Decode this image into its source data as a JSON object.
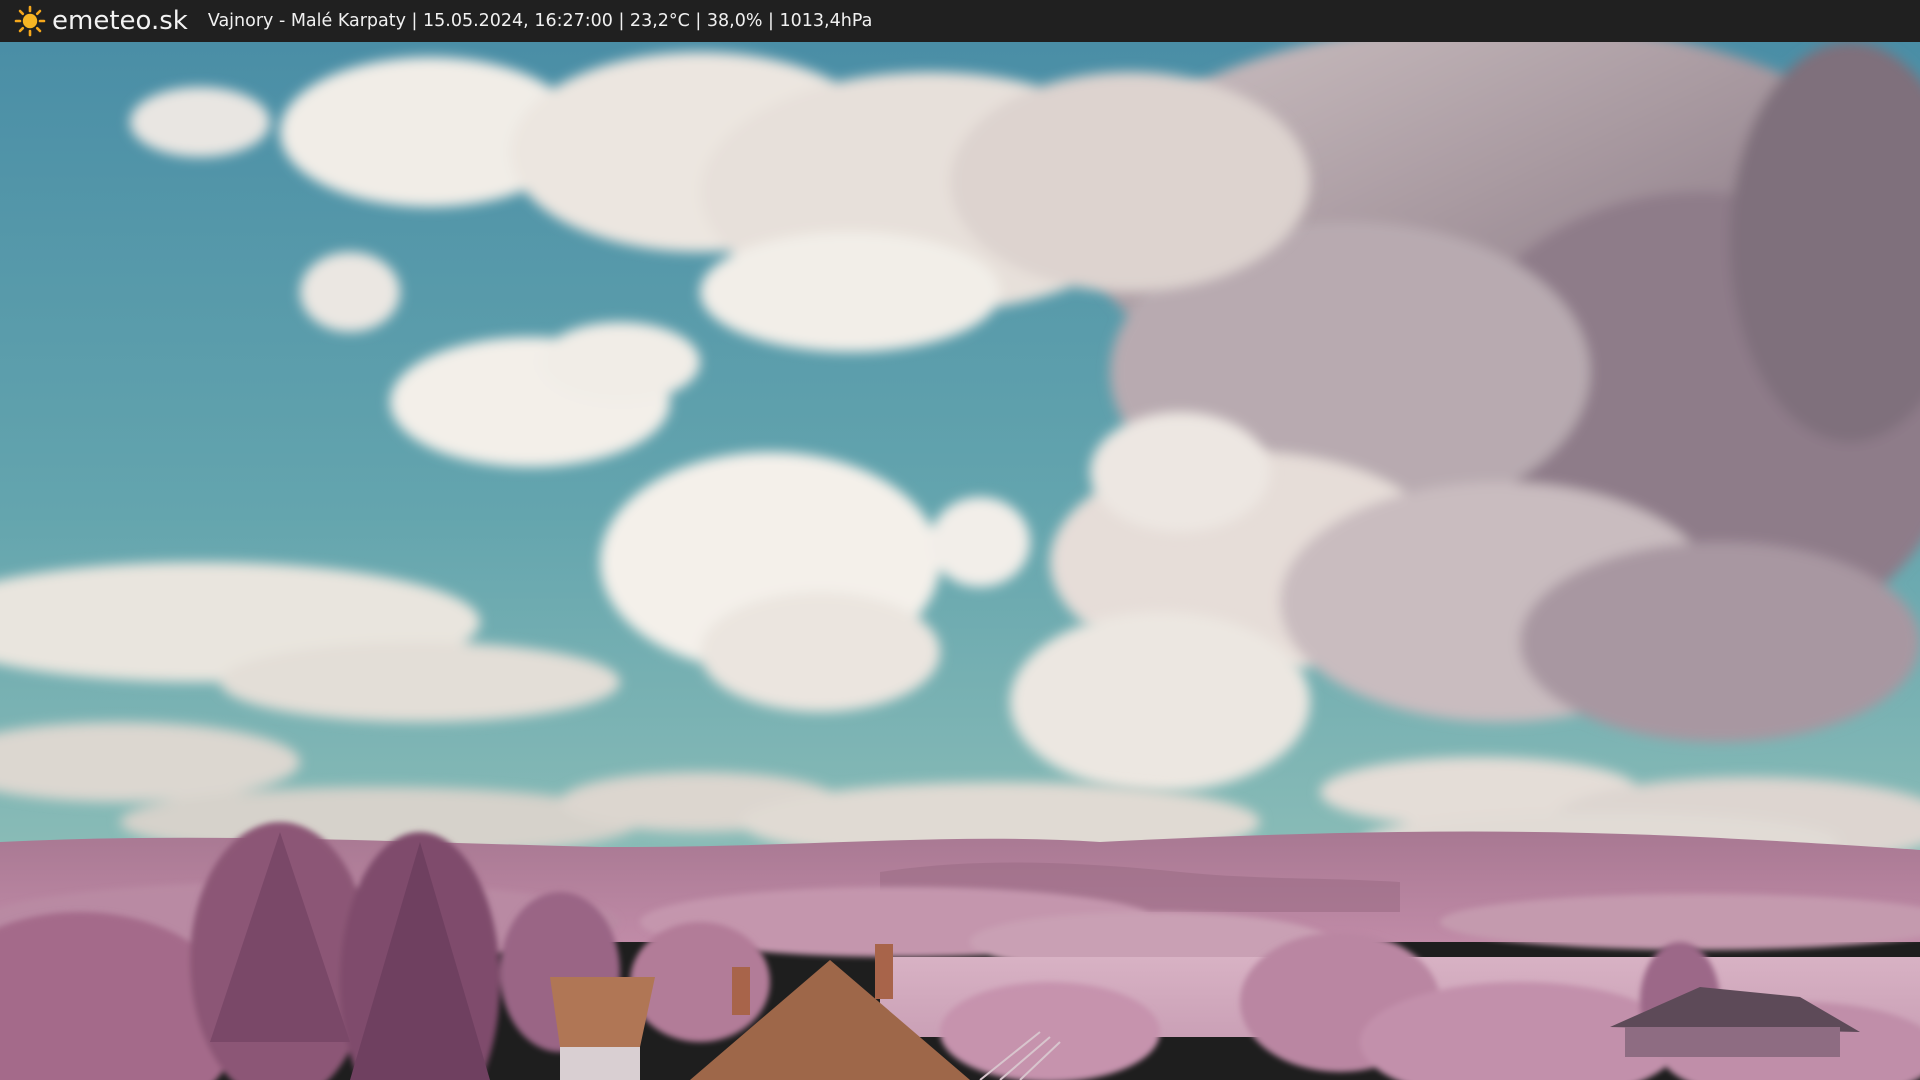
{
  "header": {
    "site_name": "emeteo.sk",
    "logo_icon": "sun-icon",
    "caption": "Vajnory - Malé Karpaty | 15.05.2024, 16:27:00 | 23,2°C | 38,0% | 1013,4hPa"
  },
  "colors": {
    "bar_background": "#202020",
    "sky_top": "#4d93a8",
    "sky_bottom": "#7fb7b3",
    "cloud_light": "#f2eee8",
    "cloud_dark": "#8c7a86",
    "foliage": "#b57e9a",
    "roof": "#a8704e"
  }
}
